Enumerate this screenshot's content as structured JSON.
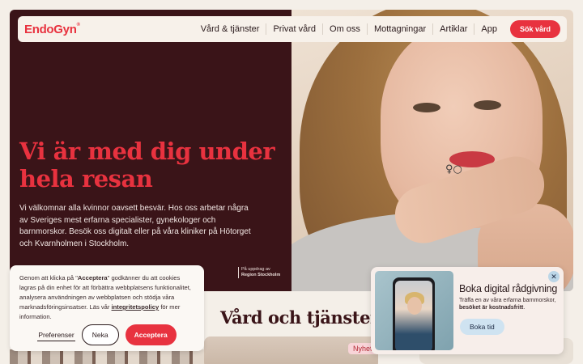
{
  "brand": {
    "logo": "EndoGyn",
    "logo_mark": "®",
    "accent": "#e8323f",
    "dark": "#3a1418"
  },
  "nav": {
    "links": [
      "Vård & tjänster",
      "Privat vård",
      "Om oss",
      "Mottagningar",
      "Artiklar",
      "App"
    ],
    "cta": "Sök vård"
  },
  "hero": {
    "headline": "Vi är med dig under hela resan",
    "intro": "Vi välkomnar alla kvinnor oavsett besvär. Hos oss arbetar några av Sveriges mest erfarna specialister, gynekologer och barnmorskor. Besök oss digitalt eller på våra kliniker på Hötorget och Kvarnholmen i Stockholm.",
    "badge_line1": "På uppdrag av",
    "badge_line2": "Region Stockholm",
    "tattoo": "♀○"
  },
  "section": {
    "title": "Vård och tjänster",
    "new_badge": "Nyhet"
  },
  "cookie": {
    "text_pre": "Genom att klicka på \"",
    "text_bold": "Acceptera",
    "text_mid": "\" godkänner du att cookies lagras på din enhet för att förbättra webbplatsens funktionalitet, analysera användningen av webbplatsen och stödja våra marknadsföringsinsatser. Läs vår ",
    "link": "integritetspolicy",
    "text_post": " för mer information.",
    "preferences": "Preferenser",
    "decline": "Neka",
    "accept": "Acceptera"
  },
  "promo": {
    "title": "Boka digital rådgivning",
    "text_pre": "Träffa en av våra erfarna barnmorskor, ",
    "text_bold": "besöket är kostnadsfritt",
    "text_post": ".",
    "button": "Boka tid",
    "close_icon": "close-icon"
  }
}
